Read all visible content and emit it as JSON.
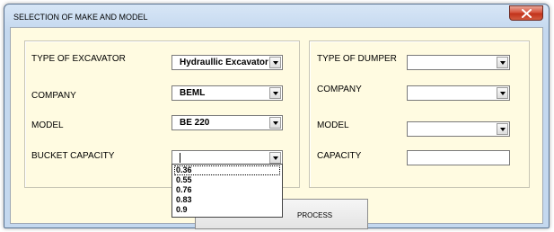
{
  "window": {
    "title": "SELECTION OF MAKE AND MODEL"
  },
  "excavator": {
    "type_label": "TYPE OF EXCAVATOR",
    "type_value": "Hydraullic Excavator",
    "company_label": "COMPANY",
    "company_value": "BEML",
    "model_label": "MODEL",
    "model_value": "BE 220",
    "bucket_label": "BUCKET CAPACITY",
    "bucket_value": "",
    "bucket_options": [
      "0.36",
      "0.55",
      "0.76",
      "0.83",
      "0.9"
    ]
  },
  "dumper": {
    "type_label": "TYPE OF DUMPER",
    "type_value": "",
    "company_label": "COMPANY",
    "company_value": "",
    "model_label": "MODEL",
    "model_value": "",
    "capacity_label": "CAPACITY",
    "capacity_value": ""
  },
  "buttons": {
    "process_label": "PROCESS"
  },
  "icons": {
    "close": "close-icon",
    "dropdown": "chevron-down-icon"
  },
  "colors": {
    "client_background": "#fffbe1",
    "title_bar": "#c4d8ef",
    "close_button": "#c2331b"
  }
}
